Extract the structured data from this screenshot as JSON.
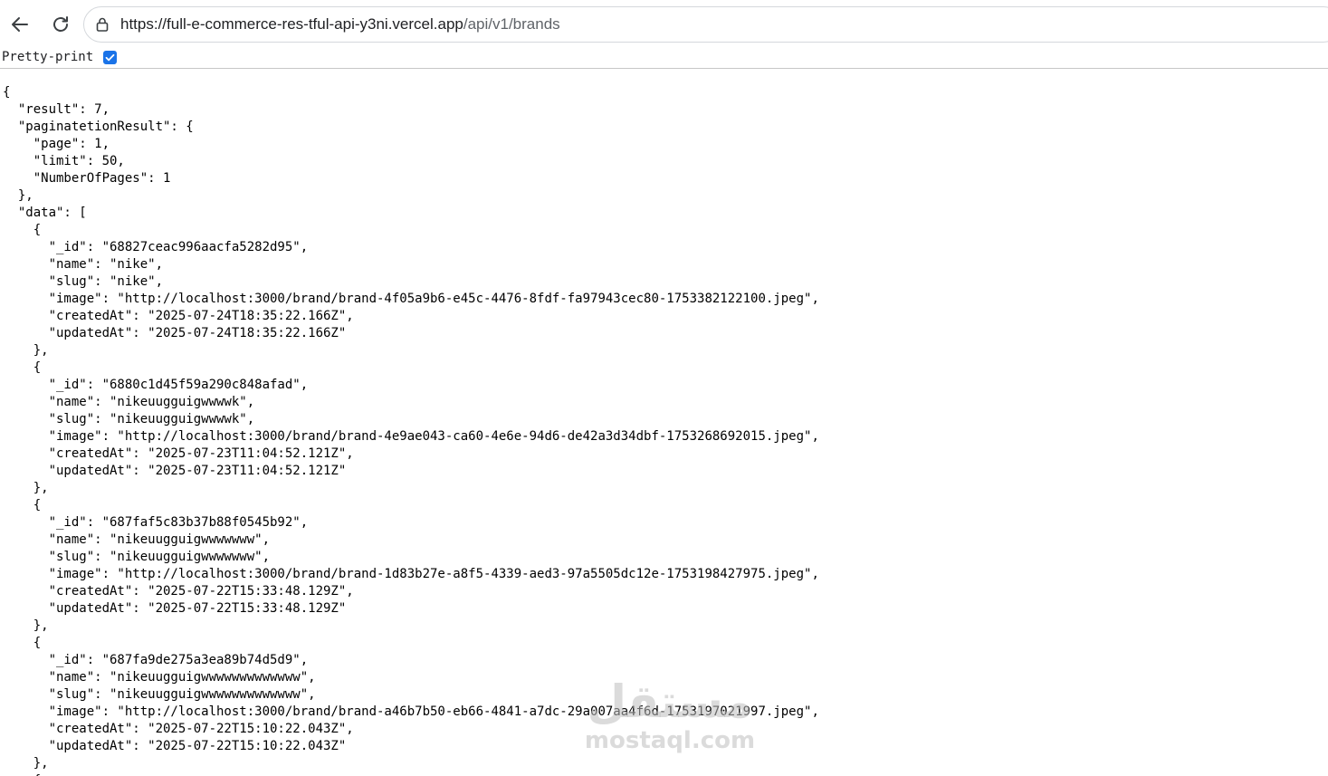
{
  "browser": {
    "url_origin": "https://full-e-commerce-res-tful-api-y3ni.vercel.app",
    "url_path": "/api/v1/brands",
    "accent_color": "#1a73e8"
  },
  "pretty_print": {
    "label": "Pretty-print",
    "checked": true
  },
  "json_lines": [
    "{",
    "  \"result\": 7,",
    "  \"paginatetionResult\": {",
    "    \"page\": 1,",
    "    \"limit\": 50,",
    "    \"NumberOfPages\": 1",
    "  },",
    "  \"data\": [",
    "    {",
    "      \"_id\": \"68827ceac996aacfa5282d95\",",
    "      \"name\": \"nike\",",
    "      \"slug\": \"nike\",",
    "      \"image\": \"http://localhost:3000/brand/brand-4f05a9b6-e45c-4476-8fdf-fa97943cec80-1753382122100.jpeg\",",
    "      \"createdAt\": \"2025-07-24T18:35:22.166Z\",",
    "      \"updatedAt\": \"2025-07-24T18:35:22.166Z\"",
    "    },",
    "    {",
    "      \"_id\": \"6880c1d45f59a290c848afad\",",
    "      \"name\": \"nikeuugguigwwwwk\",",
    "      \"slug\": \"nikeuugguigwwwwk\",",
    "      \"image\": \"http://localhost:3000/brand/brand-4e9ae043-ca60-4e6e-94d6-de42a3d34dbf-1753268692015.jpeg\",",
    "      \"createdAt\": \"2025-07-23T11:04:52.121Z\",",
    "      \"updatedAt\": \"2025-07-23T11:04:52.121Z\"",
    "    },",
    "    {",
    "      \"_id\": \"687faf5c83b37b88f0545b92\",",
    "      \"name\": \"nikeuugguigwwwwwww\",",
    "      \"slug\": \"nikeuugguigwwwwwww\",",
    "      \"image\": \"http://localhost:3000/brand/brand-1d83b27e-a8f5-4339-aed3-97a5505dc12e-1753198427975.jpeg\",",
    "      \"createdAt\": \"2025-07-22T15:33:48.129Z\",",
    "      \"updatedAt\": \"2025-07-22T15:33:48.129Z\"",
    "    },",
    "    {",
    "      \"_id\": \"687fa9de275a3ea89b74d5d9\",",
    "      \"name\": \"nikeuugguigwwwwwwwwwwwww\",",
    "      \"slug\": \"nikeuugguigwwwwwwwwwwwww\",",
    "      \"image\": \"http://localhost:3000/brand/brand-a46b7b50-eb66-4841-a7dc-29a007aa4f6d-1753197021997.jpeg\",",
    "      \"createdAt\": \"2025-07-22T15:10:22.043Z\",",
    "      \"updatedAt\": \"2025-07-22T15:10:22.043Z\"",
    "    },",
    "    {"
  ],
  "watermark": {
    "arabic": "مستقل",
    "latin": "mostaql.com"
  }
}
